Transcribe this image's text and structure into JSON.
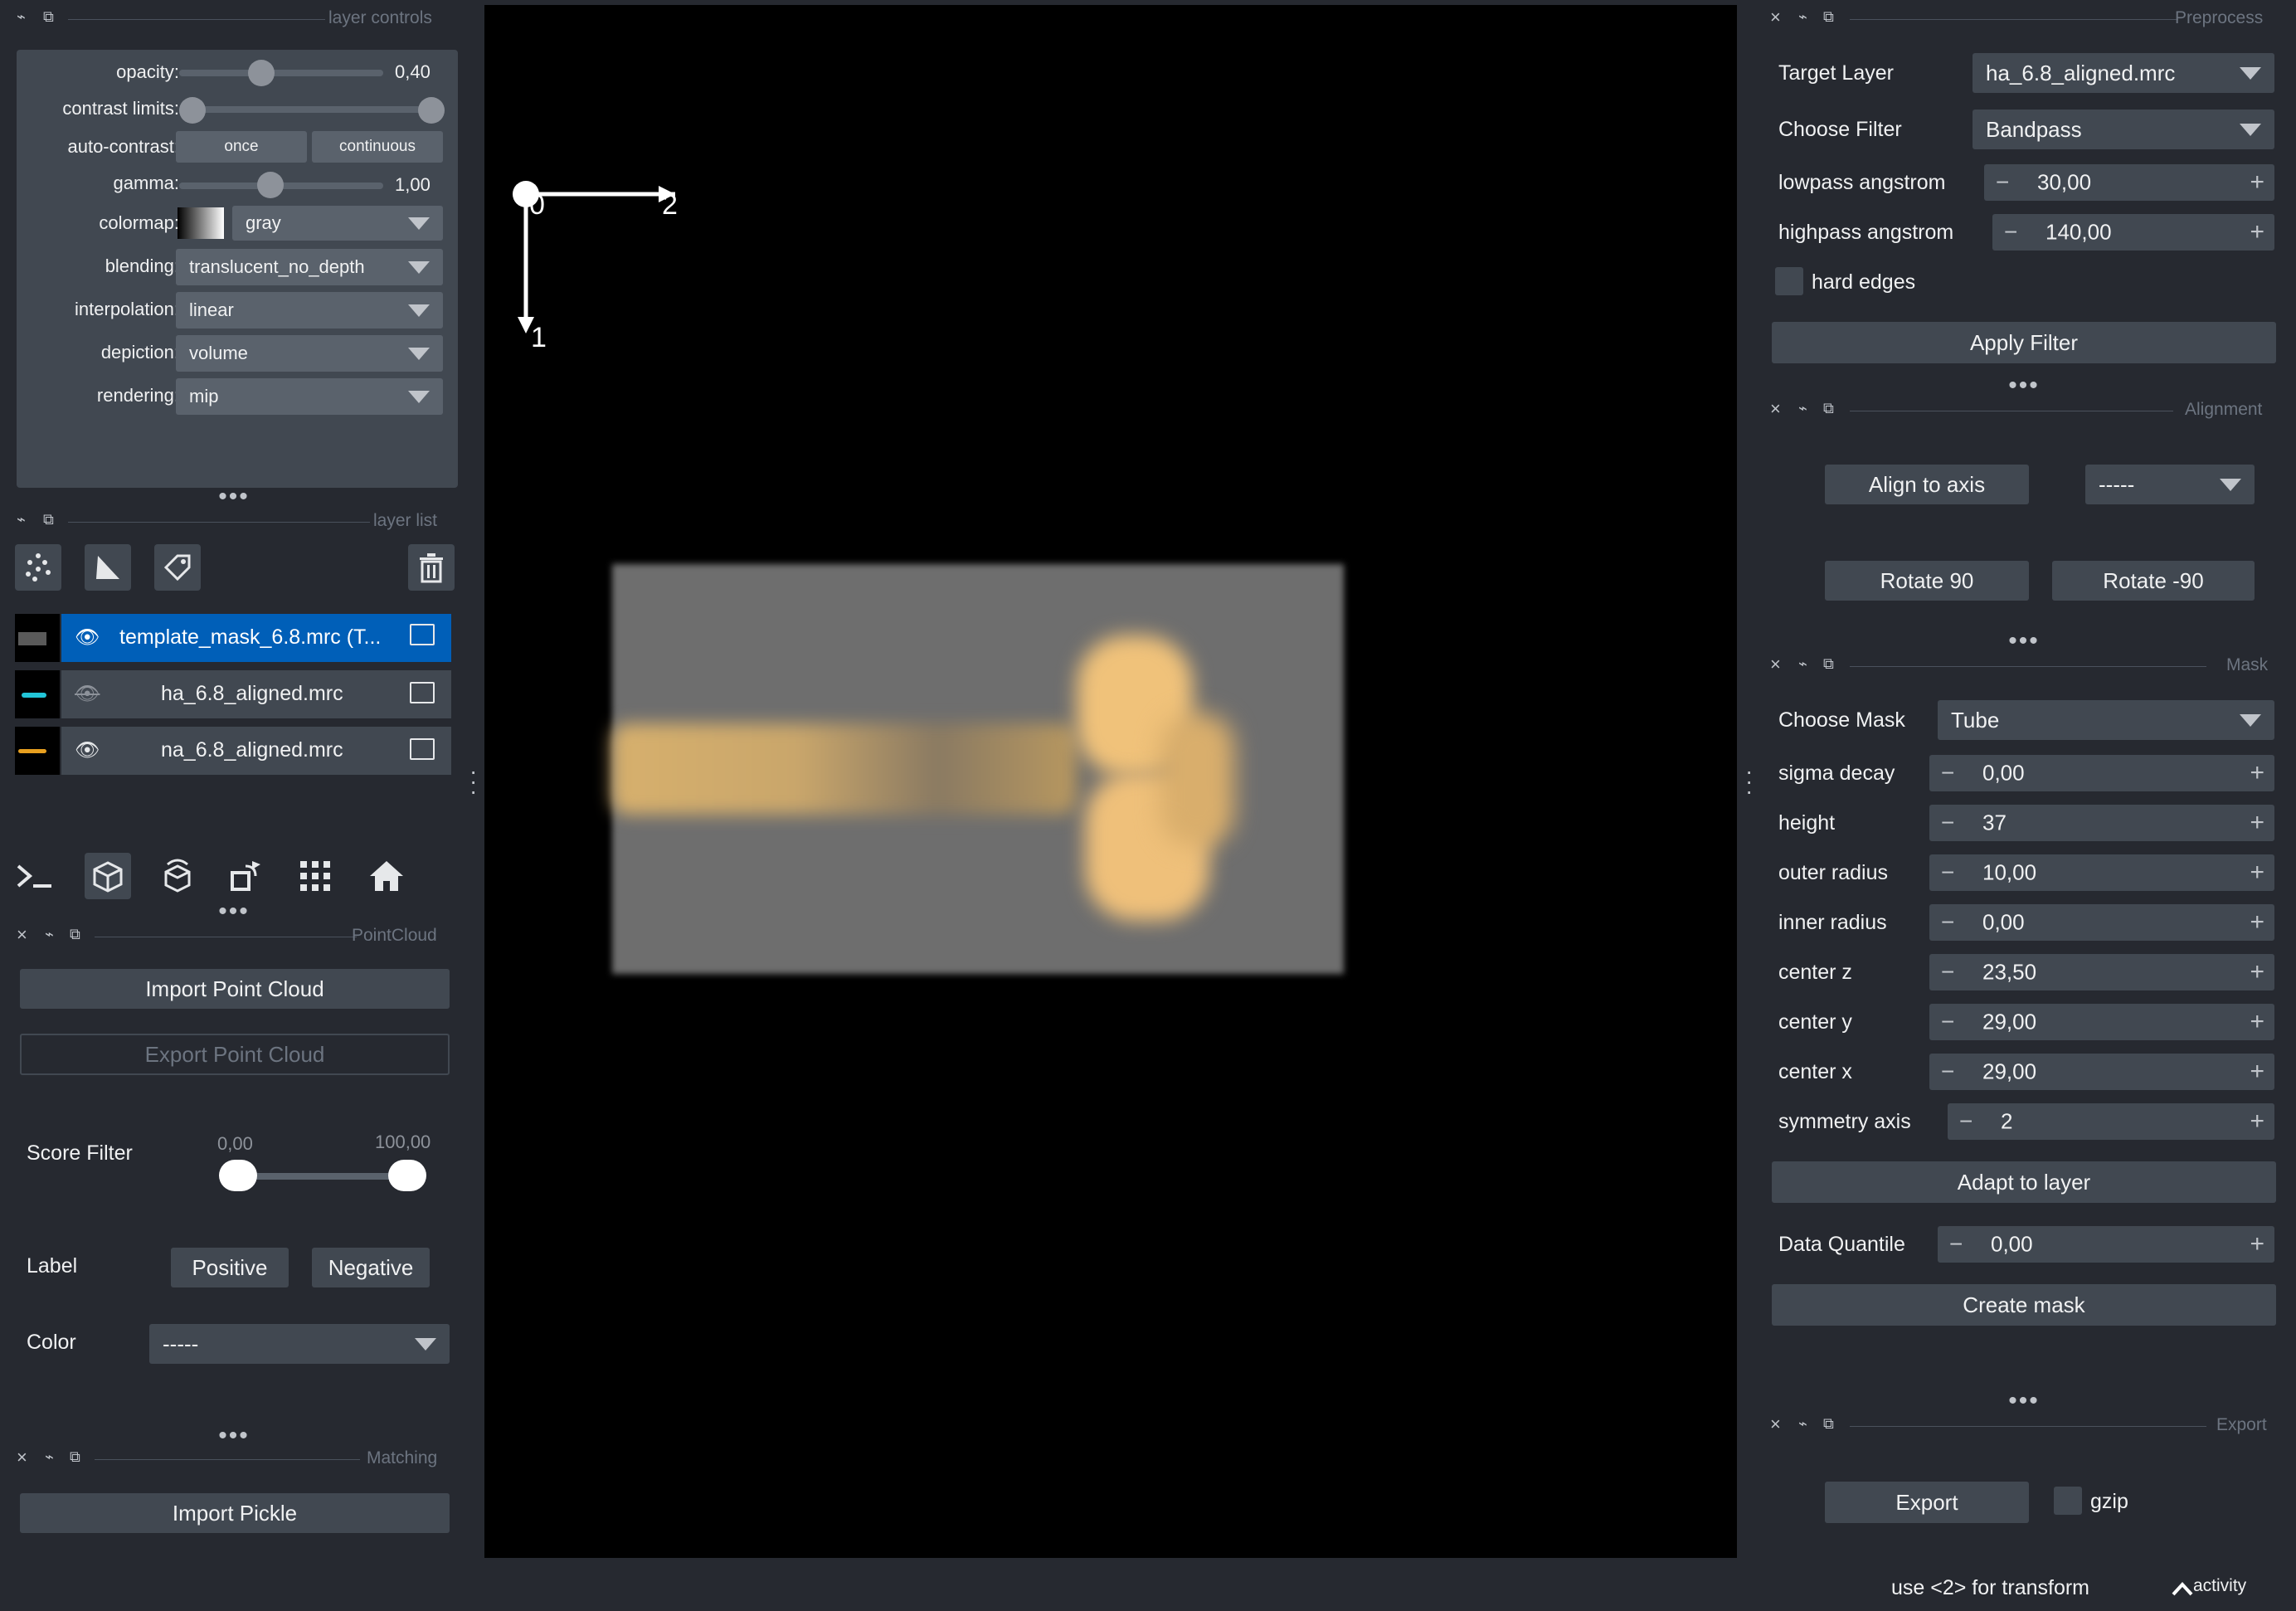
{
  "layer_controls": {
    "title": "layer controls",
    "opacity_label": "opacity:",
    "opacity_value": "0,40",
    "opacity_fraction": 0.4,
    "contrast_label": "contrast limits:",
    "autocontrast_label": "auto-contrast:",
    "once_label": "once",
    "continuous_label": "continuous",
    "gamma_label": "gamma:",
    "gamma_value": "1,00",
    "colormap_label": "colormap:",
    "colormap_value": "gray",
    "blending_label": "blending:",
    "blending_value": "translucent_no_depth",
    "interpolation_label": "interpolation:",
    "interpolation_value": "linear",
    "depiction_label": "depiction:",
    "depiction_value": "volume",
    "rendering_label": "rendering:",
    "rendering_value": "mip"
  },
  "layer_list": {
    "title": "layer list",
    "layers": [
      {
        "name": "template_mask_6.8.mrc (T...",
        "selected": true,
        "visible": true,
        "thumb_color": "#5a5a5a"
      },
      {
        "name": "ha_6.8_aligned.mrc",
        "selected": false,
        "visible": false,
        "thumb_color": "#22c5d8"
      },
      {
        "name": "na_6.8_aligned.mrc",
        "selected": false,
        "visible": true,
        "thumb_color": "#e8a020"
      }
    ]
  },
  "pointcloud": {
    "title": "PointCloud",
    "import_label": "Import Point Cloud",
    "export_label": "Export Point Cloud",
    "score_filter_label": "Score Filter",
    "score_min": "0,00",
    "score_max": "100,00",
    "label_label": "Label",
    "positive_label": "Positive",
    "negative_label": "Negative",
    "color_label": "Color",
    "color_value": "-----"
  },
  "matching": {
    "title": "Matching",
    "import_pickle_label": "Import Pickle"
  },
  "canvas": {
    "axis_0": "0",
    "axis_1": "1",
    "axis_2": "2"
  },
  "preprocess": {
    "title": "Preprocess",
    "target_layer_label": "Target Layer",
    "target_layer_value": "ha_6.8_aligned.mrc",
    "choose_filter_label": "Choose Filter",
    "choose_filter_value": "Bandpass",
    "lowpass_label": "lowpass angstrom",
    "lowpass_value": "30,00",
    "highpass_label": "highpass angstrom",
    "highpass_value": "140,00",
    "hard_edges_label": "hard edges",
    "apply_label": "Apply Filter"
  },
  "alignment": {
    "title": "Alignment",
    "align_label": "Align to axis",
    "axis_value": "-----",
    "rotate90_label": "Rotate 90",
    "rotate_neg90_label": "Rotate -90"
  },
  "mask": {
    "title": "Mask",
    "choose_mask_label": "Choose Mask",
    "choose_mask_value": "Tube",
    "fields": [
      {
        "label": "sigma decay",
        "value": "0,00"
      },
      {
        "label": "height",
        "value": "37"
      },
      {
        "label": "outer radius",
        "value": "10,00"
      },
      {
        "label": "inner radius",
        "value": "0,00"
      },
      {
        "label": "center z",
        "value": "23,50"
      },
      {
        "label": "center y",
        "value": "29,00"
      },
      {
        "label": "center x",
        "value": "29,00"
      },
      {
        "label": "symmetry axis",
        "value": "2"
      }
    ],
    "adapt_label": "Adapt to layer",
    "quantile_label": "Data Quantile",
    "quantile_value": "0,00",
    "create_label": "Create mask"
  },
  "export": {
    "title": "Export",
    "export_label": "Export",
    "gzip_label": "gzip"
  },
  "status": {
    "hint": "use <2> for transform",
    "activity_label": "activity"
  },
  "icons": {
    "close": "×",
    "float": "⧉",
    "eye": "👁",
    "ellipsis": "•••"
  }
}
